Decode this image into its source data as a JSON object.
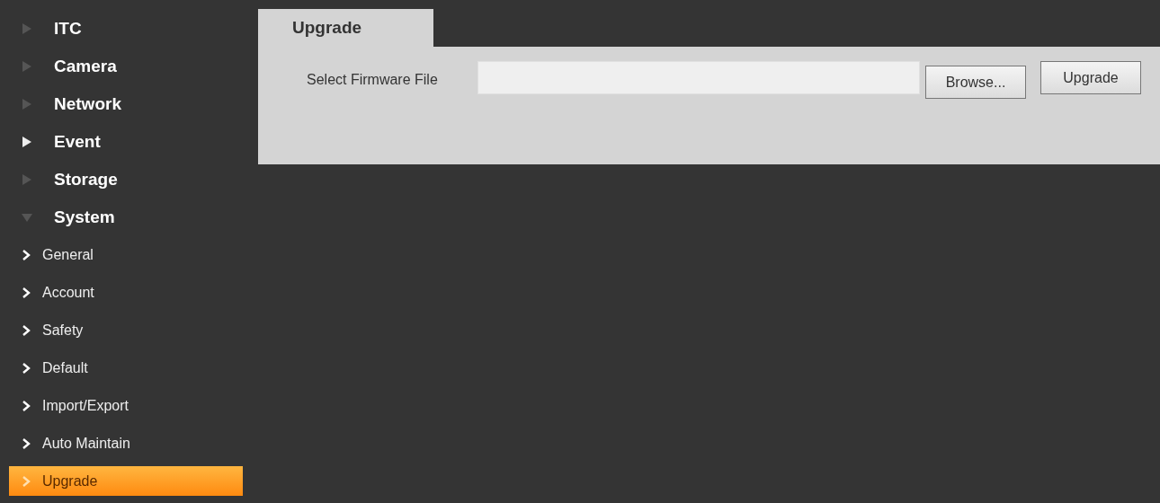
{
  "sidebar": {
    "items": [
      {
        "label": "ITC",
        "expanded": false,
        "hovered": false
      },
      {
        "label": "Camera",
        "expanded": false,
        "hovered": false
      },
      {
        "label": "Network",
        "expanded": false,
        "hovered": false
      },
      {
        "label": "Event",
        "expanded": false,
        "hovered": true
      },
      {
        "label": "Storage",
        "expanded": false,
        "hovered": false
      },
      {
        "label": "System",
        "expanded": true,
        "hovered": false,
        "children": [
          {
            "label": "General",
            "selected": false
          },
          {
            "label": "Account",
            "selected": false
          },
          {
            "label": "Safety",
            "selected": false
          },
          {
            "label": "Default",
            "selected": false
          },
          {
            "label": "Import/Export",
            "selected": false
          },
          {
            "label": "Auto Maintain",
            "selected": false
          },
          {
            "label": "Upgrade",
            "selected": true
          }
        ]
      }
    ]
  },
  "tabs": [
    {
      "label": "Upgrade",
      "selected": true
    }
  ],
  "form": {
    "label": "Select Firmware File",
    "buttons": [
      "Browse...",
      "Upgrade"
    ]
  }
}
